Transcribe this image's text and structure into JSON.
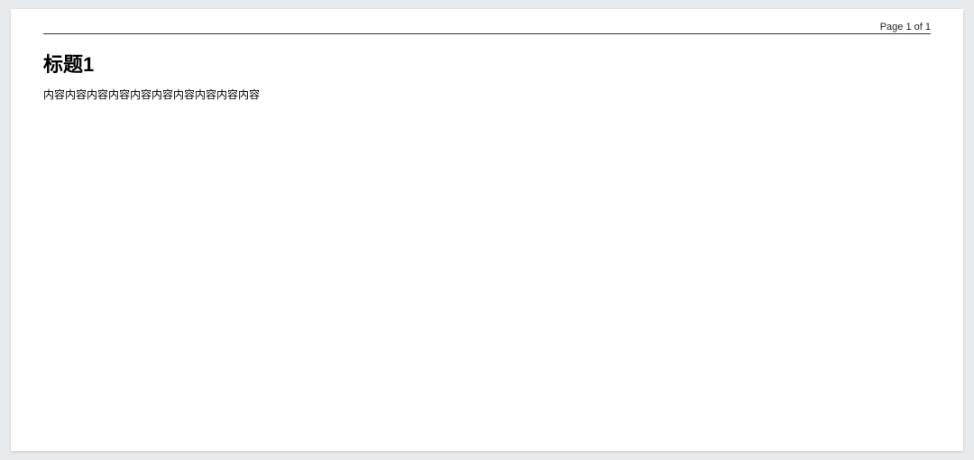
{
  "page_indicator": "Page 1 of 1",
  "heading": "标题1",
  "body": "内容内容内容内容内容内容内容内容内容内容"
}
